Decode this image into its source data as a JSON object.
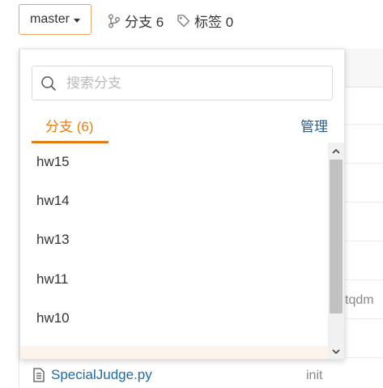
{
  "toolbar": {
    "branch_selector": "master",
    "branches_label": "分支 6",
    "tags_label": "标签 0"
  },
  "dropdown": {
    "search_placeholder": "搜索分支",
    "tab_branches": "分支 (6)",
    "manage_label": "管理",
    "branches": [
      "hw15",
      "hw14",
      "hw13",
      "hw11",
      "hw10"
    ]
  },
  "background": {
    "commit_fragment": "tqdm",
    "file_name": "SpecialJudge.py",
    "file_commit": "init"
  },
  "colors": {
    "accent": "#e57c12",
    "link": "#1e6ba6"
  }
}
